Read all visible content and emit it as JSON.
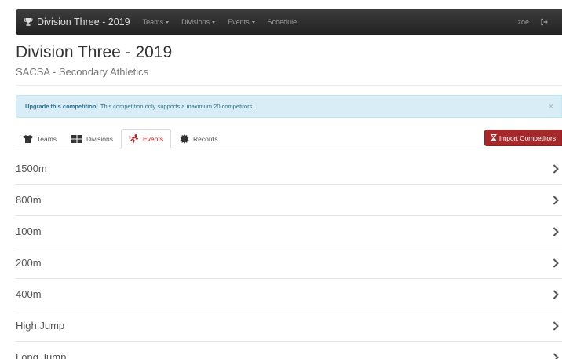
{
  "navbar": {
    "brand": "Division Three - 2019",
    "items": [
      {
        "label": "Teams"
      },
      {
        "label": "Divisions"
      },
      {
        "label": "Events"
      },
      {
        "label": "Schedule"
      }
    ],
    "user": "zoe",
    "icons": {
      "brand": "trophy-icon",
      "signout": "sign-out-icon"
    }
  },
  "header": {
    "title": "Division Three - 2019",
    "subtitle": "SACSA - Secondary Athletics"
  },
  "alert": {
    "strong": "Upgrade this competition!",
    "text": "This competition only supports a maximum 20 competitors.",
    "close": "×"
  },
  "tabs": [
    {
      "label": "Teams",
      "icon": "tshirt-icon",
      "active": false
    },
    {
      "label": "Divisions",
      "icon": "grid-icon",
      "active": false
    },
    {
      "label": "Events",
      "icon": "runner-icon",
      "active": true
    },
    {
      "label": "Records",
      "icon": "badge-icon",
      "active": false
    }
  ],
  "import_button": {
    "label": "Import Competitors",
    "icon": "hourglass-icon"
  },
  "events": [
    {
      "name": "1500m"
    },
    {
      "name": "800m"
    },
    {
      "name": "100m"
    },
    {
      "name": "200m"
    },
    {
      "name": "400m"
    },
    {
      "name": "High Jump"
    },
    {
      "name": "Long Jump"
    }
  ],
  "colors": {
    "navbar": "#222222",
    "alert_bg": "#d9edf7",
    "alert_text": "#31708f",
    "accent": "#a5282b",
    "active_tab_text": "#b71c1c"
  }
}
